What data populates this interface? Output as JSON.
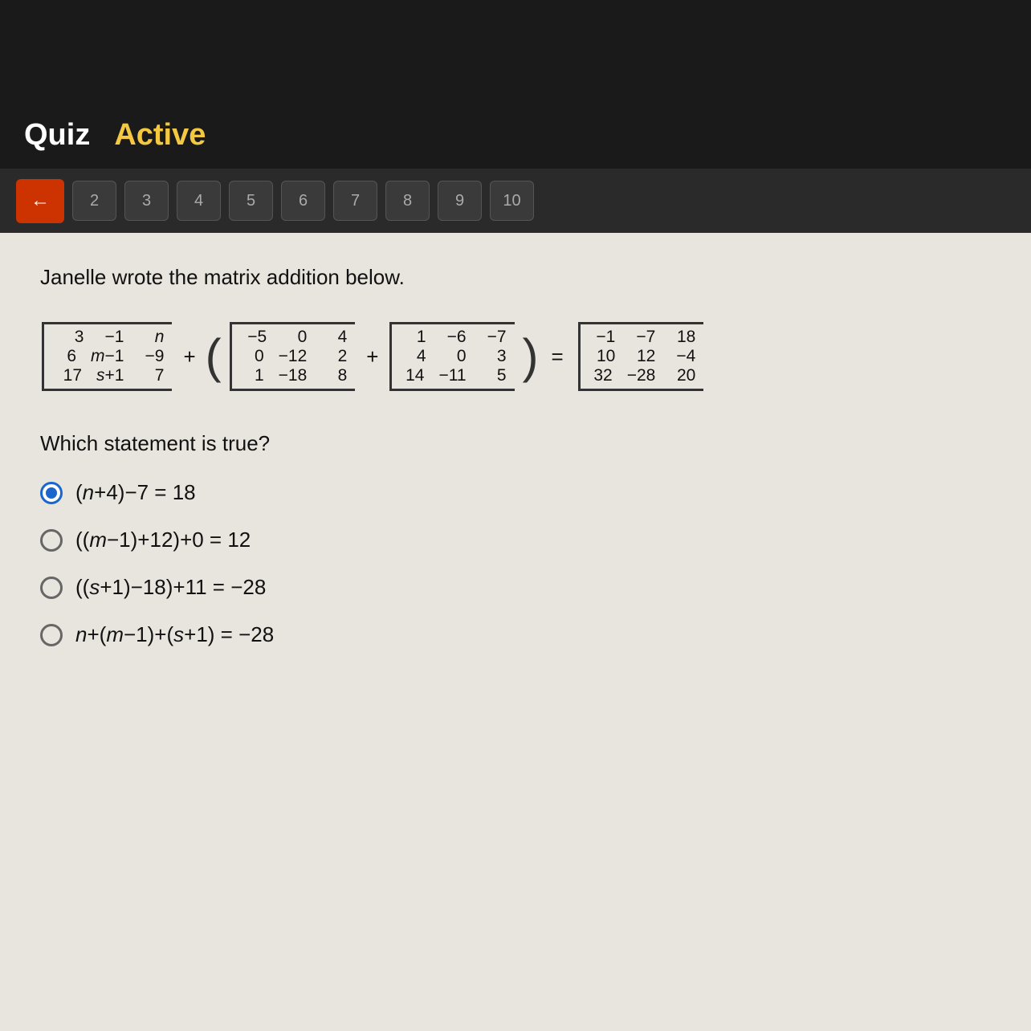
{
  "header": {
    "quiz_label": "Quiz",
    "active_label": "Active"
  },
  "nav": {
    "back_arrow": "←",
    "numbers": [
      "2",
      "3",
      "4",
      "5",
      "6",
      "7",
      "8",
      "9",
      "10"
    ]
  },
  "question": {
    "intro": "Janelle wrote the matrix addition below.",
    "which": "Which statement is true?",
    "matrix_a": {
      "rows": [
        [
          "3",
          "-1",
          "n"
        ],
        [
          "6",
          "m-1",
          "-9"
        ],
        [
          "17",
          "s+1",
          "7"
        ]
      ]
    },
    "matrix_b": {
      "rows": [
        [
          "-5",
          "0",
          "4"
        ],
        [
          "0",
          "-12",
          "2"
        ],
        [
          "1",
          "-18",
          "8"
        ]
      ]
    },
    "matrix_c": {
      "rows": [
        [
          "1",
          "-6",
          "-7"
        ],
        [
          "4",
          "0",
          "3"
        ],
        [
          "14",
          "-11",
          "5"
        ]
      ]
    },
    "matrix_r": {
      "rows": [
        [
          "-1",
          "-7",
          "18"
        ],
        [
          "10",
          "12",
          "-4"
        ],
        [
          "32",
          "-28",
          "20"
        ]
      ]
    },
    "options": [
      {
        "id": "opt1",
        "label": "(n+4)−7 = 18",
        "selected": true
      },
      {
        "id": "opt2",
        "label": "((m−1)+12)+0 = 12",
        "selected": false
      },
      {
        "id": "opt3",
        "label": "((s+1)−18)+11 = −28",
        "selected": false
      },
      {
        "id": "opt4",
        "label": "n+(m−1)+(s+1) = −28",
        "selected": false
      }
    ]
  }
}
